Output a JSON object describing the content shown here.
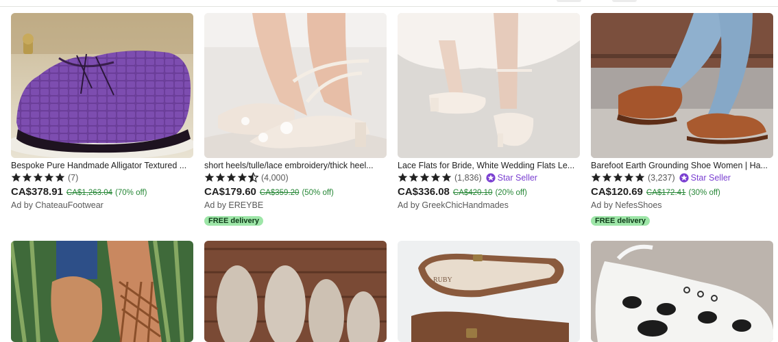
{
  "products": [
    {
      "title": "Bespoke Pure Handmade Alligator Textured ...",
      "rating_count": "(7)",
      "star_seller": false,
      "star_seller_label": "",
      "price": "CA$378.91",
      "original_price": "CA$1,263.04",
      "discount": "(70% off)",
      "seller": "Ad by ChateauFootwear",
      "free_delivery": "",
      "stars": 5
    },
    {
      "title": "short heels/tulle/lace embroidery/thick heel...",
      "rating_count": "(4,000)",
      "star_seller": false,
      "star_seller_label": "",
      "price": "CA$179.60",
      "original_price": "CA$359.20",
      "discount": "(50% off)",
      "seller": "Ad by EREYBE",
      "free_delivery": "FREE delivery",
      "stars": 4.5
    },
    {
      "title": "Lace Flats for Bride, White Wedding Flats Le...",
      "rating_count": "(1,836)",
      "star_seller": true,
      "star_seller_label": "Star Seller",
      "price": "CA$336.08",
      "original_price": "CA$420.10",
      "discount": "(20% off)",
      "seller": "Ad by GreekChicHandmades",
      "free_delivery": "",
      "stars": 5
    },
    {
      "title": "Barefoot Earth Grounding Shoe Women | Ha...",
      "rating_count": "(3,237)",
      "star_seller": true,
      "star_seller_label": "Star Seller",
      "price": "CA$120.69",
      "original_price": "CA$172.41",
      "discount": "(30% off)",
      "seller": "Ad by NefesShoes",
      "free_delivery": "FREE delivery",
      "stars": 5
    }
  ],
  "colors": {
    "star": "#222222",
    "star_seller": "#7a3fd1",
    "sale": "#258635",
    "free_delivery_bg": "#9ee6a8"
  },
  "icons": {
    "star": "star-icon",
    "star_seller": "star-seller-badge-icon"
  }
}
